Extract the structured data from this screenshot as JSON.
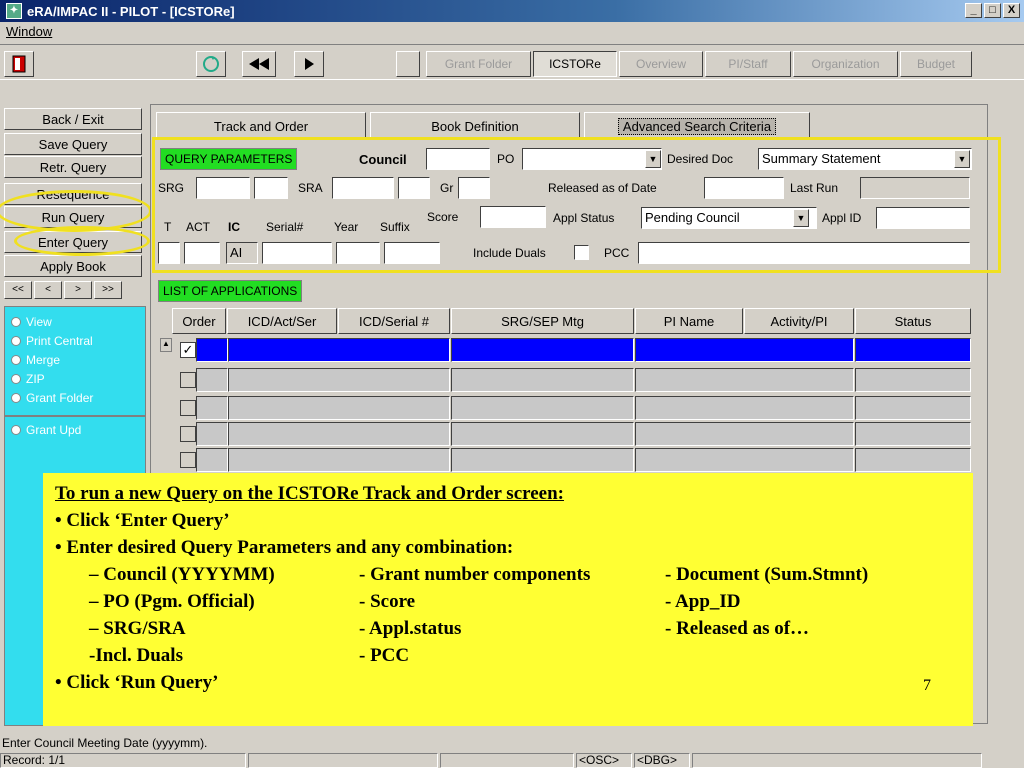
{
  "window": {
    "title": "eRA/IMPAC II - PILOT - [ICSTORe]",
    "minimize": "_",
    "maximize": "□",
    "close": "X"
  },
  "menu": {
    "window_label": "Window"
  },
  "toolbar": {
    "buttons": [
      "Grant Folder",
      "ICSTORe",
      "Overview",
      "PI/Staff",
      "Organization",
      "Budget"
    ]
  },
  "side_buttons": [
    "Back / Exit",
    "Save Query",
    "Retr. Query",
    "Resequence",
    "Run Query",
    "Enter Query",
    "Apply Book"
  ],
  "nav_buttons": [
    "<<",
    "<",
    ">",
    ">>"
  ],
  "side_radios": [
    "View",
    "Print Central",
    "Merge",
    "ZIP",
    "Grant Folder",
    "Grant Upd"
  ],
  "tabs": [
    "Track and Order",
    "Book Definition",
    "Advanced Search Criteria"
  ],
  "query": {
    "header": "QUERY PARAMETERS",
    "council_label": "Council",
    "po_label": "PO",
    "desired_doc_label": "Desired Doc",
    "desired_doc_value": "Summary Statement",
    "srg_label": "SRG",
    "sra_label": "SRA",
    "gr_label": "Gr",
    "released_label": "Released as of Date",
    "last_run_label": "Last Run",
    "t_label": "T",
    "act_label": "ACT",
    "ic_label": "IC",
    "serial_label": "Serial#",
    "year_label": "Year",
    "suffix_label": "Suffix",
    "ic_value": "AI",
    "score_label": "Score",
    "appl_status_label": "Appl Status",
    "appl_status_value": "Pending Council",
    "appl_id_label": "Appl ID",
    "include_duals_label": "Include Duals",
    "pcc_label": "PCC"
  },
  "list": {
    "header": "LIST OF APPLICATIONS",
    "columns": [
      "Order",
      "ICD/Act/Ser",
      "ICD/Serial #",
      "SRG/SEP Mtg",
      "PI Name",
      "Activity/PI",
      "Status"
    ]
  },
  "callout": {
    "title": "To run a new Query on the ICSTORe Track and Order screen:",
    "step1": "• Click ‘Enter Query’",
    "step2": "• Enter desired Query Parameters and any combination:",
    "c1r1": "– Council (YYYYMM)",
    "c2r1": "- Grant number components",
    "c3r1": "- Document (Sum.Stmnt)",
    "c1r2": "– PO (Pgm. Official)",
    "c2r2": "- Score",
    "c3r2": "- App_ID",
    "c1r3": "– SRG/SRA",
    "c2r3": "- Appl.status",
    "c3r3": "- Released as of…",
    "c1r4": "-Incl. Duals",
    "c2r4": "- PCC",
    "step3": "• Click ‘Run Query’",
    "page_number": "7"
  },
  "status": {
    "message": "Enter Council Meeting Date (yyyymm).",
    "record": "Record: 1/1",
    "osc": "<OSC>",
    "dbg": "<DBG>"
  }
}
